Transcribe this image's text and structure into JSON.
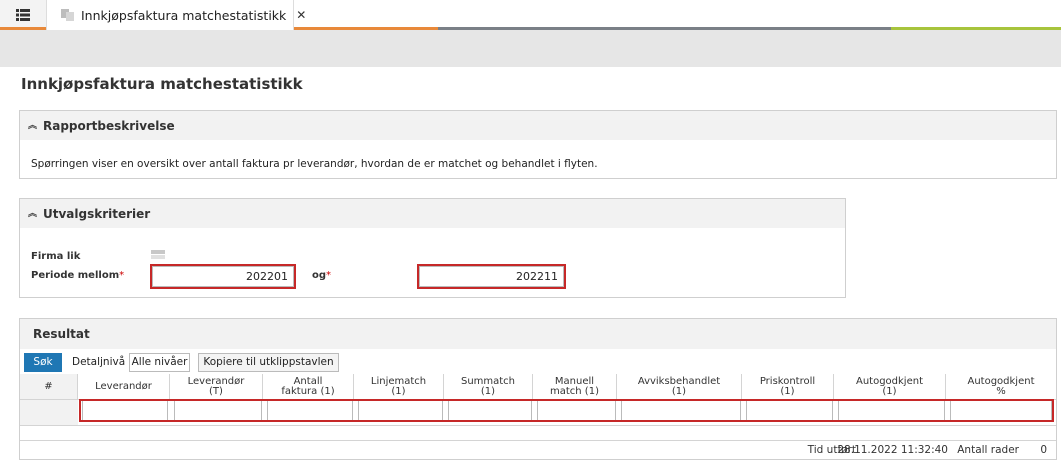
{
  "tabbar": {
    "menu_icon": "list-icon",
    "tab_title": "Innkjøpsfaktura matchestatistikk",
    "close_glyph": "✕",
    "colors": {
      "orange": "#e8893a",
      "gray": "#7a8087",
      "green": "#a7c43c"
    }
  },
  "page": {
    "title": "Innkjøpsfaktura matchestatistikk"
  },
  "report_description": {
    "header": "Rapportbeskrivelse",
    "text": "Spørringen viser en oversikt over antall faktura pr leverandør, hvordan de er matchet og behandlet i flyten."
  },
  "criteria": {
    "header": "Utvalgskriterier",
    "firma_label": "Firma lik",
    "periode_label": "Periode mellom",
    "og_label": "og",
    "required_mark": "*",
    "periode_from": "202201",
    "periode_to": "202211"
  },
  "result": {
    "header": "Resultat",
    "search_button": "Søk",
    "detail_label": "Detaljnivå",
    "all_levels_button": "Alle nivåer",
    "copy_button": "Kopiere til utklippstavlen",
    "columns": [
      {
        "line1": "#",
        "line2": ""
      },
      {
        "line1": "Leverandør",
        "line2": ""
      },
      {
        "line1": "Leverandør",
        "line2": "(T)"
      },
      {
        "line1": "Antall",
        "line2": "faktura (1)"
      },
      {
        "line1": "Linjematch",
        "line2": "(1)"
      },
      {
        "line1": "Summatch",
        "line2": "(1)"
      },
      {
        "line1": "Manuell",
        "line2": "match (1)"
      },
      {
        "line1": "Avviksbehandlet",
        "line2": "(1)"
      },
      {
        "line1": "Priskontroll",
        "line2": "(1)"
      },
      {
        "line1": "Autogodkjent",
        "line2": "(1)"
      },
      {
        "line1": "Autogodkjent",
        "line2": "%"
      }
    ],
    "footer": {
      "time_label": "Tid utført",
      "time_value": "28.11.2022 11:32:40",
      "rows_label": "Antall rader",
      "rows_value": "0"
    }
  }
}
